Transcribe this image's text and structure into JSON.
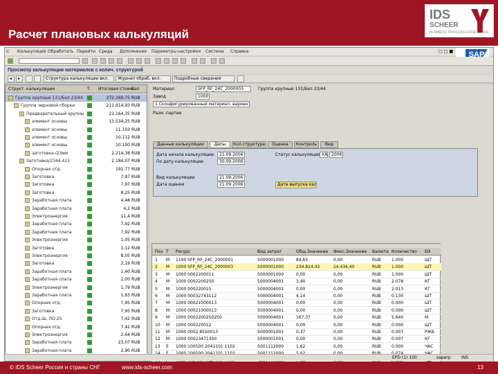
{
  "slide": {
    "title": "Расчет плановых калькуляций",
    "footer_left": "© IDS Scheer Россия и страны СНГ",
    "footer_url": "www.ids-scheer.com",
    "page_number": "13"
  },
  "logo": {
    "line1": "IDS",
    "line2": "SCHEER",
    "line3": "BUSINESS PROCESS EXCELLENCE"
  },
  "sap": {
    "logo": "SAP",
    "menu": [
      "Калькуляция",
      "Обработать",
      "Перейти",
      "Среда",
      "Дополнения",
      "Параметры настройки",
      "Система",
      "Справка"
    ],
    "page_title": "Просмотр калькуляции материалов с колич. структурой",
    "app_buttons": [
      "Структура калькуляции вкл.",
      "Журнал обраб. вкл.",
      "Подробные сведения"
    ],
    "tree": {
      "headers": [
        "Структ. калькуляции",
        "Т.",
        "Итоговая стоим.",
        "Вал"
      ],
      "rows": [
        {
          "label": "Группа крупные 131/Бел 23/44",
          "amount": "272.160,75",
          "cur": "RUB",
          "indent": 0,
          "sel": true
        },
        {
          "label": "Группа черновой сборки",
          "amount": "211.914,93",
          "cur": "RUB",
          "indent": 1,
          "sel": false
        },
        {
          "label": "Предварительный крупный",
          "amount": "21.164,35",
          "cur": "RUB",
          "indent": 2,
          "sel": false
        },
        {
          "label": "элемент основы",
          "amount": "13.534,25",
          "cur": "RUB",
          "indent": 3,
          "sel": false
        },
        {
          "label": "элемент основы",
          "amount": "11.103",
          "cur": "RUB",
          "indent": 3,
          "sel": false
        },
        {
          "label": "элемент основы",
          "amount": "10.112",
          "cur": "RUB",
          "indent": 3,
          "sel": false
        },
        {
          "label": "элемент основы",
          "amount": "10.100",
          "cur": "RUB",
          "indent": 3,
          "sel": false
        },
        {
          "label": "заготовка /23мм",
          "amount": "2.214,38",
          "cur": "RUB",
          "indent": 3,
          "sel": false
        },
        {
          "label": "Заготовка/2344.413",
          "amount": "2.184,07",
          "cur": "RUB",
          "indent": 2,
          "sel": false
        },
        {
          "label": "Опорная отд.",
          "amount": "191,77",
          "cur": "RUB",
          "indent": 3,
          "sel": false
        },
        {
          "label": "Заготовка",
          "amount": "7,97",
          "cur": "RUB",
          "indent": 3,
          "sel": false
        },
        {
          "label": "Заготовка",
          "amount": "7,97",
          "cur": "RUB",
          "indent": 3,
          "sel": false
        },
        {
          "label": "Заготовка",
          "amount": "8,25",
          "cur": "RUB",
          "indent": 3,
          "sel": false
        },
        {
          "label": "Заработная плата",
          "amount": "4,48",
          "cur": "RUB",
          "indent": 3,
          "sel": false
        },
        {
          "label": "Заработная плата",
          "amount": "4,2",
          "cur": "RUB",
          "indent": 3,
          "sel": false
        },
        {
          "label": "Электроэнергия",
          "amount": "11,4",
          "cur": "RUB",
          "indent": 3,
          "sel": false
        },
        {
          "label": "Заработная плата",
          "amount": "7,92",
          "cur": "RUB",
          "indent": 3,
          "sel": false
        },
        {
          "label": "Заработная плата",
          "amount": "7,92",
          "cur": "RUB",
          "indent": 3,
          "sel": false
        },
        {
          "label": "Электроэнергия",
          "amount": "1,05",
          "cur": "RUB",
          "indent": 3,
          "sel": false
        },
        {
          "label": "Заготовка",
          "amount": "1,12",
          "cur": "RUB",
          "indent": 3,
          "sel": false
        },
        {
          "label": "Электроэнергия",
          "amount": "8,05",
          "cur": "RUB",
          "indent": 3,
          "sel": false
        },
        {
          "label": "Заготовка",
          "amount": "2,19",
          "cur": "RUB",
          "indent": 3,
          "sel": false
        },
        {
          "label": "Заработная плата",
          "amount": "1,40",
          "cur": "RUB",
          "indent": 3,
          "sel": false
        },
        {
          "label": "Заработная плата",
          "amount": "2,00",
          "cur": "RUB",
          "indent": 3,
          "sel": false
        },
        {
          "label": "Электроэнергия",
          "amount": "1,79",
          "cur": "RUB",
          "indent": 3,
          "sel": false
        },
        {
          "label": "Заработная плата",
          "amount": "1,63",
          "cur": "RUB",
          "indent": 3,
          "sel": false
        },
        {
          "label": "Опорная отд.",
          "amount": "7,95",
          "cur": "RUB",
          "indent": 3,
          "sel": false
        },
        {
          "label": "Заготовка",
          "amount": "7,95",
          "cur": "RUB",
          "indent": 3,
          "sel": false
        },
        {
          "label": "Отд.Ш, ЛО-25",
          "amount": "7,42",
          "cur": "RUB",
          "indent": 3,
          "sel": false
        },
        {
          "label": "Опорная отд.",
          "amount": "7,42",
          "cur": "RUB",
          "indent": 3,
          "sel": false
        },
        {
          "label": "Электроэнергия",
          "amount": "2,64",
          "cur": "RUB",
          "indent": 3,
          "sel": false
        },
        {
          "label": "Заработная плата",
          "amount": "23,07",
          "cur": "RUB",
          "indent": 3,
          "sel": false
        },
        {
          "label": "Заработная плата",
          "amount": "2,90",
          "cur": "RUB",
          "indent": 3,
          "sel": false
        }
      ]
    },
    "header_fields": {
      "material_label": "Материал",
      "material_value": "SFP_RF_24C_2000003",
      "material_desc": "Группа крупные 131/Бел 23/44",
      "plant_label": "Завод",
      "plant_value": "1000",
      "variant_label": "Вариант калькуляции",
      "variant_value": "1 Сконфигурированный материал, вариант 11",
      "lot_label": "Разм. партии"
    },
    "tabs": [
      "Данные калькуляции",
      "Даты",
      "Кол.структура",
      "Оценка",
      "Контроль",
      "Вид"
    ],
    "dates": {
      "from_label": "Дата начала калькуляции",
      "from_value": "21.09.2006",
      "to_label": "По дату калькуляции",
      "to_value": "30.09.2006",
      "state_label": "Статус калькуляции",
      "state_value": "КА",
      "kind_label": "Вид калькуляции",
      "kind_value": "21.09.2006",
      "valuation_label": "Дата оценки",
      "valuation_value": "21.09.2006",
      "qty_label": "Количество",
      "qty_value": "2006",
      "dual_label": "Дата выпуска",
      "btn_label": "Дата выпуска калькуляции"
    },
    "grid": {
      "headers": [
        "Поз",
        "Т",
        "Ресурс",
        "Вид затрат",
        "Общ.Значение",
        "Фикс.Значение",
        "Валюта",
        "Количество",
        "ЕИ"
      ],
      "rows": [
        {
          "pos": "1",
          "t": "M",
          "res": "1100 SFP_RF_24C_2000001",
          "cost": "5000001000",
          "total": "84,65",
          "fixed": "0,00",
          "cur": "RUB",
          "qty": "1.000",
          "uom": "ШТ"
        },
        {
          "pos": "2",
          "t": "M",
          "res": "1000 SFP_RF_24C_2000003",
          "cost": "5000001000",
          "total": "234.814,43",
          "fixed": "24.434,40",
          "cur": "RUB",
          "qty": "1.000",
          "uom": "ШТ"
        },
        {
          "pos": "3",
          "t": "M",
          "res": "1000 0002200011",
          "cost": "5000001000",
          "total": "0,00",
          "fixed": "0,00",
          "cur": "RUB",
          "qty": "1.000",
          "uom": "ШТ"
        },
        {
          "pos": "4",
          "t": "M",
          "res": "1000 0002200250",
          "cost": "5000004001",
          "total": "3,40",
          "fixed": "0,00",
          "cur": "RUB",
          "qty": "2.078",
          "uom": "КГ"
        },
        {
          "pos": "5",
          "t": "M",
          "res": "1000 000220015",
          "cost": "5000004001",
          "total": "0,00",
          "fixed": "0,00",
          "cur": "RUB",
          "qty": "2.013",
          "uom": "КГ"
        },
        {
          "pos": "6",
          "t": "M",
          "res": "1000 00032743112",
          "cost": "5000004001",
          "total": "4,14",
          "fixed": "0,00",
          "cur": "RUB",
          "qty": "0.130",
          "uom": "ШТ"
        },
        {
          "pos": "7",
          "t": "M",
          "res": "1000 00021000013",
          "cost": "5000004001",
          "total": "0,00",
          "fixed": "0,00",
          "cur": "RUB",
          "qty": "0.000",
          "uom": "ШТ"
        },
        {
          "pos": "8",
          "t": "M",
          "res": "1000 00021000013",
          "cost": "5000004001",
          "total": "0,00",
          "fixed": "0,00",
          "cur": "RUB",
          "qty": "0.000",
          "uom": "ШТ"
        },
        {
          "pos": "9",
          "t": "M",
          "res": "1000 0002200250250",
          "cost": "5000004001",
          "total": "167,37",
          "fixed": "0,00",
          "cur": "RUB",
          "qty": "5.640",
          "uom": "М"
        },
        {
          "pos": "10",
          "t": "M",
          "res": "1000 000220012",
          "cost": "5000004001",
          "total": "0,00",
          "fixed": "0,00",
          "cur": "RUB",
          "qty": "0.000",
          "uom": "ШТ"
        },
        {
          "pos": "11",
          "t": "M",
          "res": "1000 0002 8550013",
          "cost": "5000001001",
          "total": "0,37",
          "fixed": "0,00",
          "cur": "RUB",
          "qty": "0.007",
          "uom": "РЖБ"
        },
        {
          "pos": "12",
          "t": "M",
          "res": "1000 00023471300",
          "cost": "5000001001",
          "total": "0,00",
          "fixed": "0,00",
          "cur": "RUB",
          "qty": "0.007",
          "uom": "КГ"
        },
        {
          "pos": "13",
          "t": "E",
          "res": "1000 100500 2041101 1102",
          "cost": "5001112000",
          "total": "1,62",
          "fixed": "0,00",
          "cur": "RUB",
          "qty": "0.000",
          "uom": "ЧАС"
        },
        {
          "pos": "14",
          "t": "E",
          "res": "1000 100500 2041101 1102",
          "cost": "5001112000",
          "total": "5,02",
          "fixed": "0,00",
          "cur": "RUB",
          "qty": "0.074",
          "uom": "ЧАС"
        },
        {
          "pos": "15",
          "t": "E",
          "res": "1000 100500 2041101 1102",
          "cost": "5001112000",
          "total": "1,00",
          "fixed": "0,00",
          "cur": "RUB",
          "qty": "0.000",
          "uom": "ЧАС"
        },
        {
          "pos": "16",
          "t": "E",
          "res": "1000 100500 2041101 1102",
          "cost": "5001112000",
          "total": "0,98",
          "fixed": "0,00",
          "cur": "RUB",
          "qty": "0.000",
          "uom": "ЧАС"
        }
      ]
    },
    "status": {
      "system": "EPD (1) 100",
      "server": "saperp",
      "mode": "INS"
    }
  }
}
